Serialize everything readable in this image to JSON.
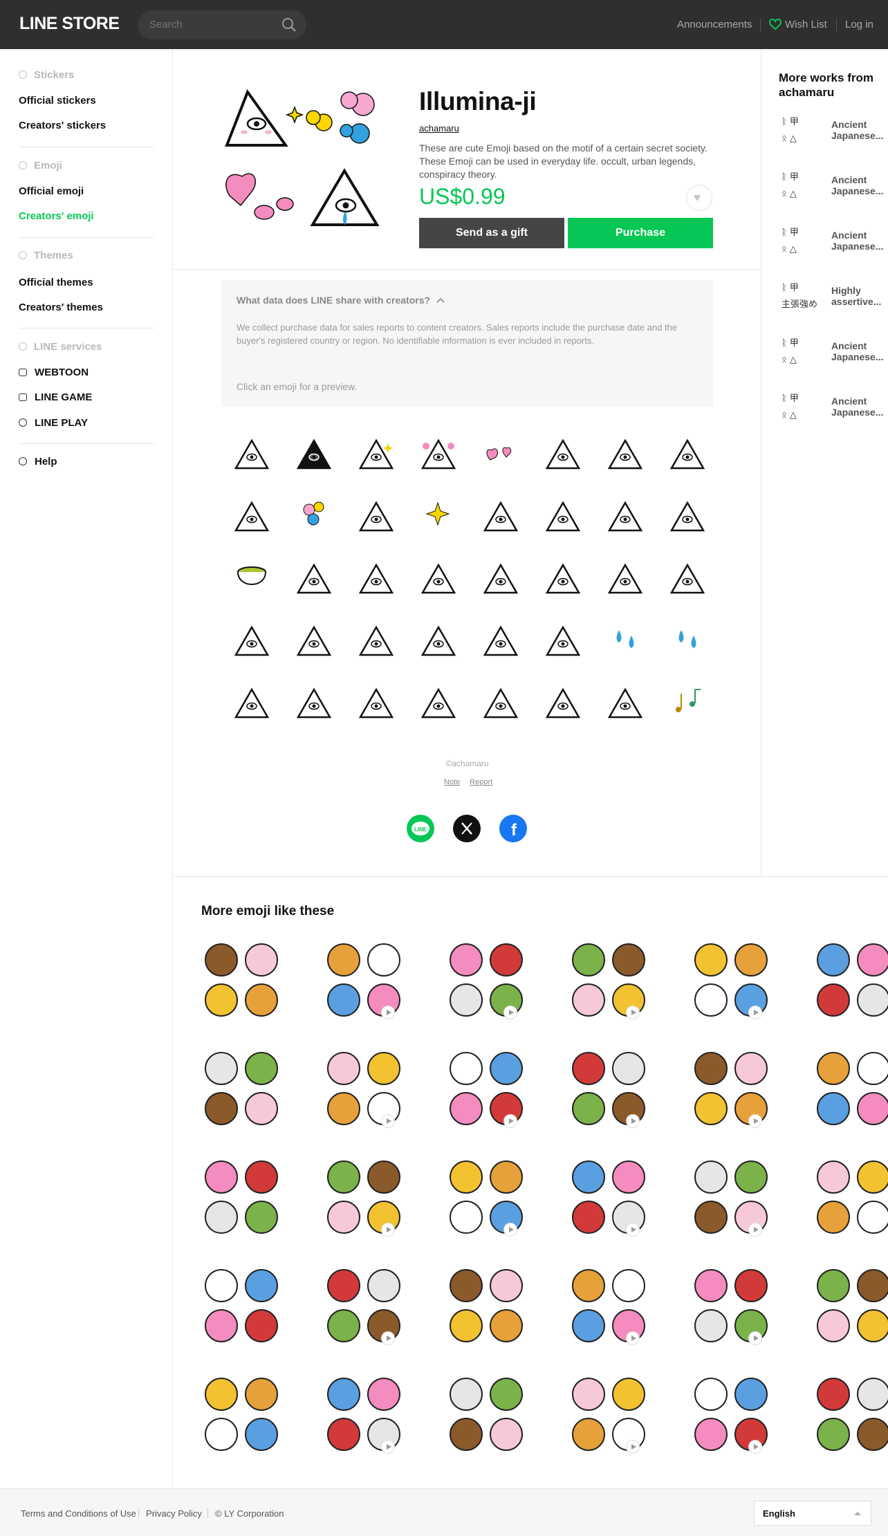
{
  "header": {
    "logo_line": "LINE",
    "logo_store": "STORE",
    "search_placeholder": "Search",
    "nav": [
      "Announcements",
      "Wish List",
      "Log in"
    ]
  },
  "sidebar": {
    "sections": [
      {
        "heading": "Stickers",
        "items": [
          "Official stickers",
          "Creators' stickers"
        ]
      },
      {
        "heading": "Emoji",
        "items": [
          "Official emoji",
          "Creators' emoji"
        ]
      },
      {
        "heading": "Themes",
        "items": [
          "Official themes",
          "Creators' themes"
        ]
      },
      {
        "heading": "LINE services",
        "items": [
          "WEBTOON",
          "LINE GAME",
          "LINE PLAY"
        ]
      }
    ],
    "help": "Help",
    "active": "Creators' emoji"
  },
  "product": {
    "title": "Illumina-ji",
    "author": "achamaru",
    "description": "These are cute Emoji based on the motif of a certain secret society. These Emoji can be used in everyday life. occult, urban legends, conspiracy theory.",
    "price": "US$0.99",
    "gift_label": "Send as a gift",
    "purchase_label": "Purchase"
  },
  "data_notice": {
    "title": "What data does LINE share with creators?",
    "body": "We collect purchase data for sales reports to content creators. Sales reports include the purchase date and the buyer's registered country or region. No identifiable information is ever included in reports.",
    "preview_hint": "Click an emoji for a preview."
  },
  "emoji_count": 40,
  "copyright": "©achamaru",
  "links": [
    "Note",
    "Report"
  ],
  "share": [
    "line-share-icon",
    "x-share-icon",
    "facebook-share-icon"
  ],
  "more_works": {
    "heading": "More works from achamaru",
    "items": [
      "Ancient Japanese...",
      "Ancient Japanese...",
      "Ancient Japanese...",
      "Highly assertive...",
      "Ancient Japanese...",
      "Ancient Japanese..."
    ]
  },
  "more_like": {
    "heading": "More emoji like these",
    "count": 30
  },
  "footer": {
    "links": [
      "Terms and Conditions of Use",
      "Privacy Policy",
      "© LY Corporation"
    ],
    "language": "English"
  },
  "colors": {
    "brand_green": "#06c755",
    "header_bg": "#2f2f2f"
  }
}
